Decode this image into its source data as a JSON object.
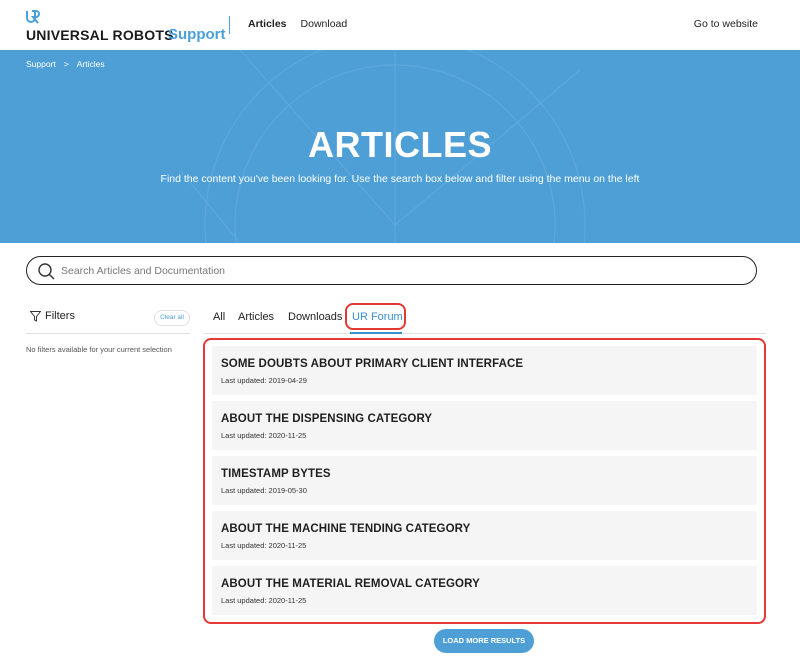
{
  "header": {
    "brand": "UNIVERSAL ROBOTS",
    "brand_sub": "Support",
    "nav": [
      "Articles",
      "Download"
    ],
    "go_to_website": "Go to website"
  },
  "hero": {
    "breadcrumb": [
      "Support",
      ">",
      "Articles"
    ],
    "title": "ARTICLES",
    "subtitle": "Find the content you've been looking for. Use the search box below and filter using the menu on the left",
    "bg_color": "#4e9fd6"
  },
  "search": {
    "placeholder": "Search Articles and Documentation",
    "value": ""
  },
  "filters": {
    "title": "Filters",
    "clear_all": "Clear all",
    "empty_message": "No filters available for your current selection"
  },
  "tabs": {
    "items": [
      "All",
      "Articles",
      "Downloads",
      "UR Forum"
    ],
    "active": "UR Forum"
  },
  "results": [
    {
      "title": "SOME DOUBTS ABOUT PRIMARY CLIENT INTERFACE",
      "updated": "Last updated: 2019-04-29"
    },
    {
      "title": "ABOUT THE DISPENSING CATEGORY",
      "updated": "Last updated: 2020-11-25"
    },
    {
      "title": "TIMESTAMP BYTES",
      "updated": "Last updated: 2019-05-30"
    },
    {
      "title": "ABOUT THE MACHINE TENDING CATEGORY",
      "updated": "Last updated: 2020-11-25"
    },
    {
      "title": "ABOUT THE MATERIAL REMOVAL CATEGORY",
      "updated": "Last updated: 2020-11-25"
    }
  ],
  "load_more": "LOAD MORE RESULTS",
  "colors": {
    "accent": "#4aa0d9",
    "highlight": "#e53935"
  }
}
